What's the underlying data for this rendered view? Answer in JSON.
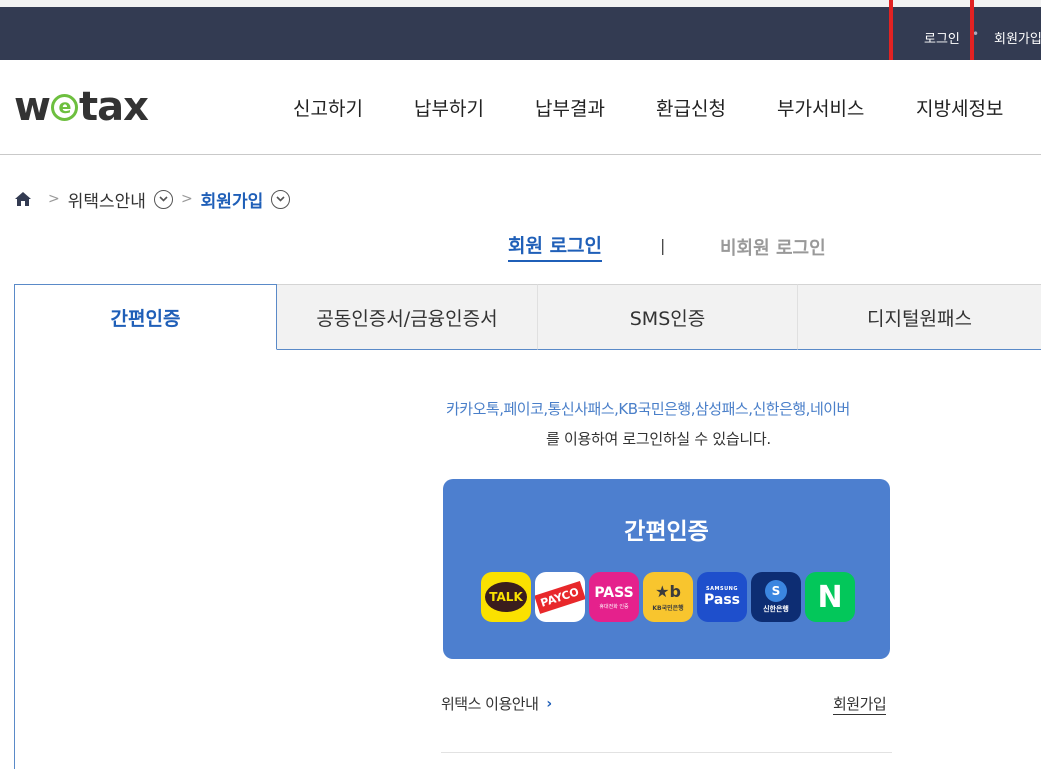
{
  "topbar": {
    "login": "로그인",
    "separator": "•",
    "join": "회원가입"
  },
  "header": {
    "logo": {
      "left": "w",
      "mid": "e",
      "right": "tax"
    },
    "nav": [
      "신고하기",
      "납부하기",
      "납부결과",
      "환급신청",
      "부가서비스",
      "지방세정보"
    ]
  },
  "breadcrumb": {
    "level1": "위택스안내",
    "level2": "회원가입"
  },
  "login_type": {
    "member": "회원 로그인",
    "separator": "|",
    "guest": "비회원 로그인"
  },
  "tabs": [
    "간편인증",
    "공동인증서/금융인증서",
    "SMS인증",
    "디지털원패스"
  ],
  "content": {
    "desc_line1": "카카오톡,페이코,통신사패스,KB국민은행,삼성패스,신한은행,네이버",
    "desc_line2": "를 이용하여 로그인하실 수 있습니다.",
    "box_title": "간편인증",
    "apps": {
      "kakao": "TALK",
      "payco": "PAYCO",
      "pass": "PASS",
      "pass_sub": "휴대전화 인증",
      "kb": "★b",
      "kb_sub": "KB국민은행",
      "samsung_sub": "SAMSUNG",
      "samsung": "Pass",
      "shinhan_logo": "S",
      "shinhan": "신한은행",
      "naver": "N"
    },
    "guide_link": "위택스 이용안내",
    "guide_arrow": "›",
    "join_link": "회원가입"
  },
  "colors": {
    "topbar": "#333b52",
    "accent": "#1f5fb8",
    "box": "#4d7fcf",
    "highlight": "#e22222"
  }
}
